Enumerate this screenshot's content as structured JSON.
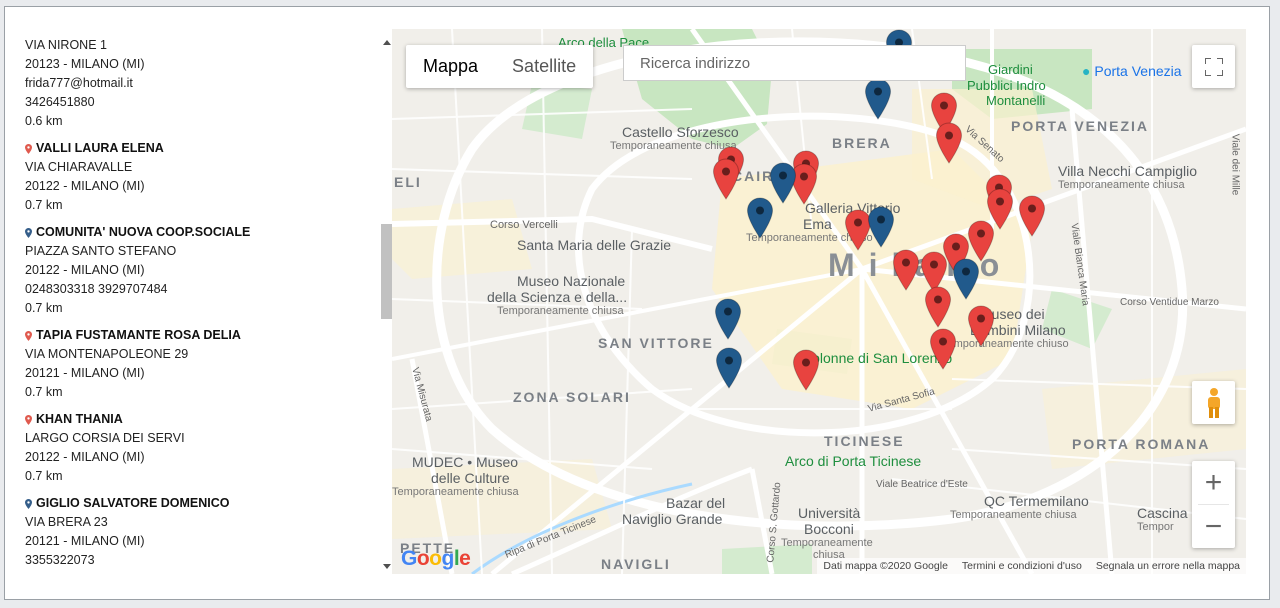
{
  "list": {
    "entries": [
      {
        "pin_color": "",
        "name": "",
        "lines": [
          "VIA NIRONE 1",
          "20123 - MILANO (MI)",
          "frida777@hotmail.it",
          "3426451880",
          "0.6 km"
        ]
      },
      {
        "pin_color": "#e05a4e",
        "name": "VALLI LAURA ELENA",
        "lines": [
          "VIA CHIARAVALLE",
          "20122 - MILANO (MI)",
          "0.7 km"
        ]
      },
      {
        "pin_color": "#355e8a",
        "name": "COMUNITA' NUOVA COOP.SOCIALE",
        "lines": [
          "PIAZZA SANTO STEFANO",
          "20122 - MILANO (MI)",
          "0248303318 3929707484",
          "0.7 km"
        ]
      },
      {
        "pin_color": "#e05a4e",
        "name": "TAPIA FUSTAMANTE ROSA DELIA",
        "lines": [
          "VIA MONTENAPOLEONE 29",
          "20121 - MILANO (MI)",
          "0.7 km"
        ]
      },
      {
        "pin_color": "#e05a4e",
        "name": "KHAN THANIA",
        "lines": [
          "LARGO CORSIA DEI SERVI",
          "20122 - MILANO (MI)",
          "0.7 km"
        ]
      },
      {
        "pin_color": "#355e8a",
        "name": "GIGLIO SALVATORE DOMENICO",
        "lines": [
          "VIA BRERA 23",
          "20121 - MILANO (MI)",
          "3355322073"
        ]
      }
    ]
  },
  "map": {
    "maptype": {
      "map_label": "Mappa",
      "satellite_label": "Satellite"
    },
    "search": {
      "placeholder": "Ricerca indirizzo"
    },
    "zoom": {
      "in": "+",
      "out": "−"
    },
    "google_logo": "Google",
    "attribution": {
      "data": "Dati mappa ©2020 Google",
      "terms": "Termini e condizioni d'uso",
      "report": "Segnala un errore nella mappa"
    },
    "colors": {
      "red_marker": "#e8433f",
      "blue_marker": "#215a8c"
    },
    "labels": {
      "arco_pace": "Arco della Pace",
      "giardini": "Giardini",
      "pubblici": "Pubblici Indro",
      "montanelli": "Montanelli",
      "porta_venezia": "Porta Venezia",
      "castello": "Castello Sforzesco",
      "temp1": "Temporaneamente chiusa",
      "brera": "BRERA",
      "porta_venezia_d": "PORTA VENEZIA",
      "via_senato": "Via Senato",
      "villa_necchi": "Villa Necchi Campiglio",
      "temp2": "Temporaneamente chiusa",
      "via_lele": "Viale dei Mille",
      "eli": "ELI",
      "cairoli": "CAIROLI",
      "corso_vercelli": "Corso Vercelli",
      "galleria": "Galleria Vittorio",
      "ema": "Ema",
      "temp3": "Temporaneamente chiuso",
      "santa_maria": "Santa Maria delle Grazie",
      "via_bianca": "Viale Bianca Maria",
      "milano": "Milano",
      "museo": "Museo Nazionale",
      "scienza": "della Scienza e della...",
      "temp4": "Temporaneamente chiusa",
      "corso_ventidue": "Corso Ventidue Marzo",
      "museo_bambini": "Museo dei",
      "bambini": "Bambini Milano",
      "temp5": "Temporaneamente chiuso",
      "san_vittore": "SAN VITTORE",
      "colonne": "Colonne di San Lorenzo",
      "zona_solari": "ZONA SOLARI",
      "via_santa_sofia": "Via Santa Sofia",
      "via_misurata": "Via Misurata",
      "ticinese": "TICINESE",
      "porta_romana": "PORTA ROMANA",
      "mudec": "MUDEC • Museo",
      "culture": "delle Culture",
      "temp6": "Temporaneamente chiusa",
      "arco_ticinese": "Arco di Porta Ticinese",
      "viale_beatrice": "Viale Beatrice d'Este",
      "qc": "QC Termemilano",
      "temp7": "Temporaneamente chiusa",
      "bazar": "Bazar del",
      "naviglio_grande": "Naviglio Grande",
      "universita": "Università",
      "bocconi": "Bocconi",
      "temp8": "Temporaneamente",
      "chiusa": "chiusa",
      "cascina": "Cascina",
      "temp9": "Tempor",
      "ripa": "Ripa di Porta Ticinese",
      "corso_gottardo": "Corso S. Gottardo",
      "navigli": "NAVIGLI",
      "zona_tortona": "PETTE"
    }
  }
}
